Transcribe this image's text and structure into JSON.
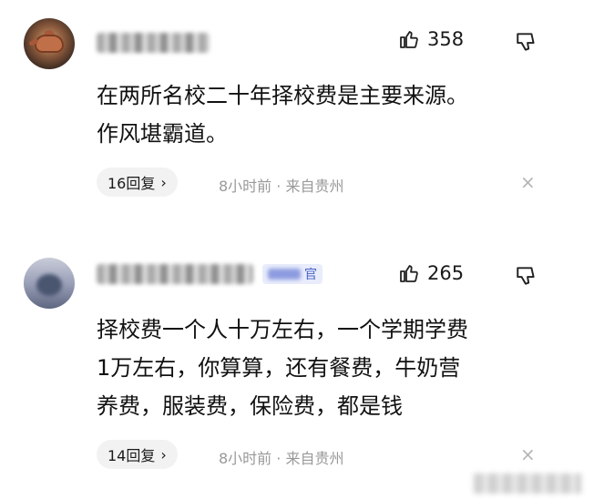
{
  "comments": [
    {
      "likes": "358",
      "text_lines": [
        "在两所名校二十年择校费是主要来源。",
        "作风堪霸道。"
      ],
      "replies": "16回复",
      "reply_chevron": "›",
      "meta": "8小时前 · 来自贵州",
      "close": "×"
    },
    {
      "official_badge": "官",
      "likes": "265",
      "text_lines": [
        "择校费一个人十万左右，一个学期学费",
        "1万左右，你算算，还有餐费，牛奶营",
        "养费，服装费，保险费，都是钱"
      ],
      "replies": "14回复",
      "reply_chevron": "›",
      "meta": "8小时前 · 来自贵州",
      "close": "×"
    }
  ],
  "icons": {
    "like": "thumbs-up-icon",
    "dislike": "thumbs-down-icon"
  }
}
